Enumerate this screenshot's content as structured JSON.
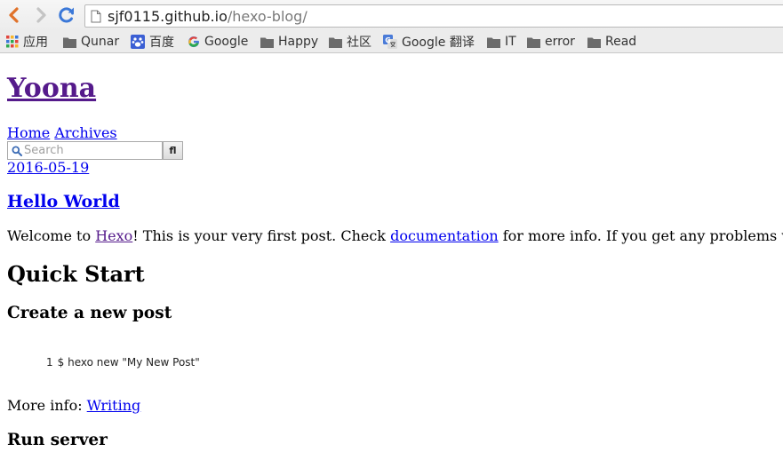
{
  "browser": {
    "url_host": "sjf0115.github.io",
    "url_path": "/hexo-blog/",
    "bookmarks": [
      {
        "label": "应用",
        "icon": "apps-grid-icon"
      },
      {
        "label": "Qunar",
        "icon": "folder-icon"
      },
      {
        "label": "百度",
        "icon": "baidu-paw-icon"
      },
      {
        "label": "Google",
        "icon": "google-g-icon"
      },
      {
        "label": "Happy",
        "icon": "folder-icon"
      },
      {
        "label": "社区",
        "icon": "folder-icon"
      },
      {
        "label": "Google 翻译",
        "icon": "google-translate-icon"
      },
      {
        "label": "IT",
        "icon": "folder-icon"
      },
      {
        "label": "error",
        "icon": "folder-icon"
      },
      {
        "label": "Read",
        "icon": "folder-icon"
      }
    ]
  },
  "site": {
    "title": "Yoona",
    "nav": [
      "Home",
      "Archives"
    ],
    "search_placeholder": "Search",
    "search_button": "fl"
  },
  "post": {
    "date": "2016-05-19",
    "title": "Hello World",
    "intro_1": "Welcome to ",
    "intro_link_1": "Hexo",
    "intro_2": "! This is your very first post. Check ",
    "intro_link_2": "documentation",
    "intro_3": " for more info. If you get any problems when using Hexo, you can find",
    "heading_quick_start": "Quick Start",
    "heading_create_post": "Create a new post",
    "code_line_number": "1",
    "code_text": "$ hexo new \"My New Post\"",
    "more_info_label": "More info: ",
    "more_info_link": "Writing",
    "heading_run_server": "Run server"
  },
  "colors": {
    "link": "#0000ee",
    "visited_link": "#551a8b",
    "back_arrow": "#e0722a",
    "reload": "#3b78d8"
  }
}
